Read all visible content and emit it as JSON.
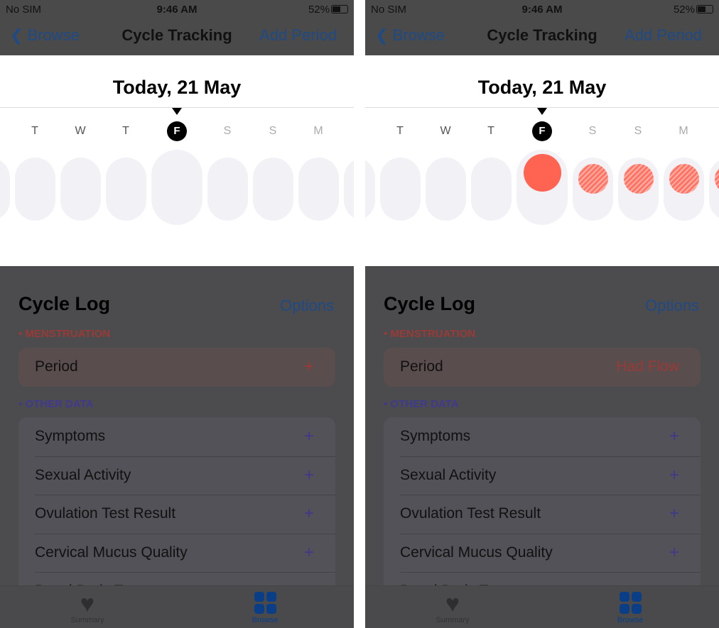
{
  "panels": [
    {
      "status": {
        "carrier": "No SIM",
        "time": "9:46 AM",
        "battery": "52%"
      },
      "nav": {
        "back": "Browse",
        "title": "Cycle Tracking",
        "action": "Add Period"
      },
      "date_title": "Today, 21 May",
      "days": [
        {
          "label": "T",
          "state": "past"
        },
        {
          "label": "W",
          "state": "past"
        },
        {
          "label": "T",
          "state": "past"
        },
        {
          "label": "F",
          "state": "today"
        },
        {
          "label": "S",
          "state": "future"
        },
        {
          "label": "S",
          "state": "future"
        },
        {
          "label": "M",
          "state": "future"
        }
      ],
      "day_marks": [
        "none",
        "none",
        "none",
        "none",
        "none",
        "none",
        "none",
        "none",
        "none"
      ],
      "log": {
        "title": "Cycle Log",
        "options": "Options",
        "menstruation_header": "MENSTRUATION",
        "period": {
          "label": "Period",
          "value": "+"
        },
        "other_header": "OTHER DATA",
        "other_items": [
          "Symptoms",
          "Sexual Activity",
          "Ovulation Test Result",
          "Cervical Mucus Quality",
          "Basal Body Temperature"
        ],
        "add_icon": "+"
      },
      "tabs": [
        {
          "label": "Summary",
          "icon": "heart-icon",
          "active": false
        },
        {
          "label": "Browse",
          "icon": "grid-icon",
          "active": true
        }
      ]
    },
    {
      "status": {
        "carrier": "No SIM",
        "time": "9:46 AM",
        "battery": "52%"
      },
      "nav": {
        "back": "Browse",
        "title": "Cycle Tracking",
        "action": "Add Period"
      },
      "date_title": "Today, 21 May",
      "days": [
        {
          "label": "T",
          "state": "past"
        },
        {
          "label": "W",
          "state": "past"
        },
        {
          "label": "T",
          "state": "past"
        },
        {
          "label": "F",
          "state": "today"
        },
        {
          "label": "S",
          "state": "future"
        },
        {
          "label": "S",
          "state": "future"
        },
        {
          "label": "M",
          "state": "future"
        }
      ],
      "day_marks": [
        "none",
        "none",
        "none",
        "none",
        "logged",
        "predicted",
        "predicted",
        "predicted",
        "predicted"
      ],
      "log": {
        "title": "Cycle Log",
        "options": "Options",
        "menstruation_header": "MENSTRUATION",
        "period": {
          "label": "Period",
          "value": "Had Flow"
        },
        "other_header": "OTHER DATA",
        "other_items": [
          "Symptoms",
          "Sexual Activity",
          "Ovulation Test Result",
          "Cervical Mucus Quality",
          "Basal Body Temperature"
        ],
        "add_icon": "+"
      },
      "tabs": [
        {
          "label": "Summary",
          "icon": "heart-icon",
          "active": false
        },
        {
          "label": "Browse",
          "icon": "grid-icon",
          "active": true
        }
      ]
    }
  ],
  "colors": {
    "accent": "#1e4a86",
    "period": "#ff6452",
    "menstruation_header": "#9a3a36",
    "other_header": "#3f3a8e"
  }
}
